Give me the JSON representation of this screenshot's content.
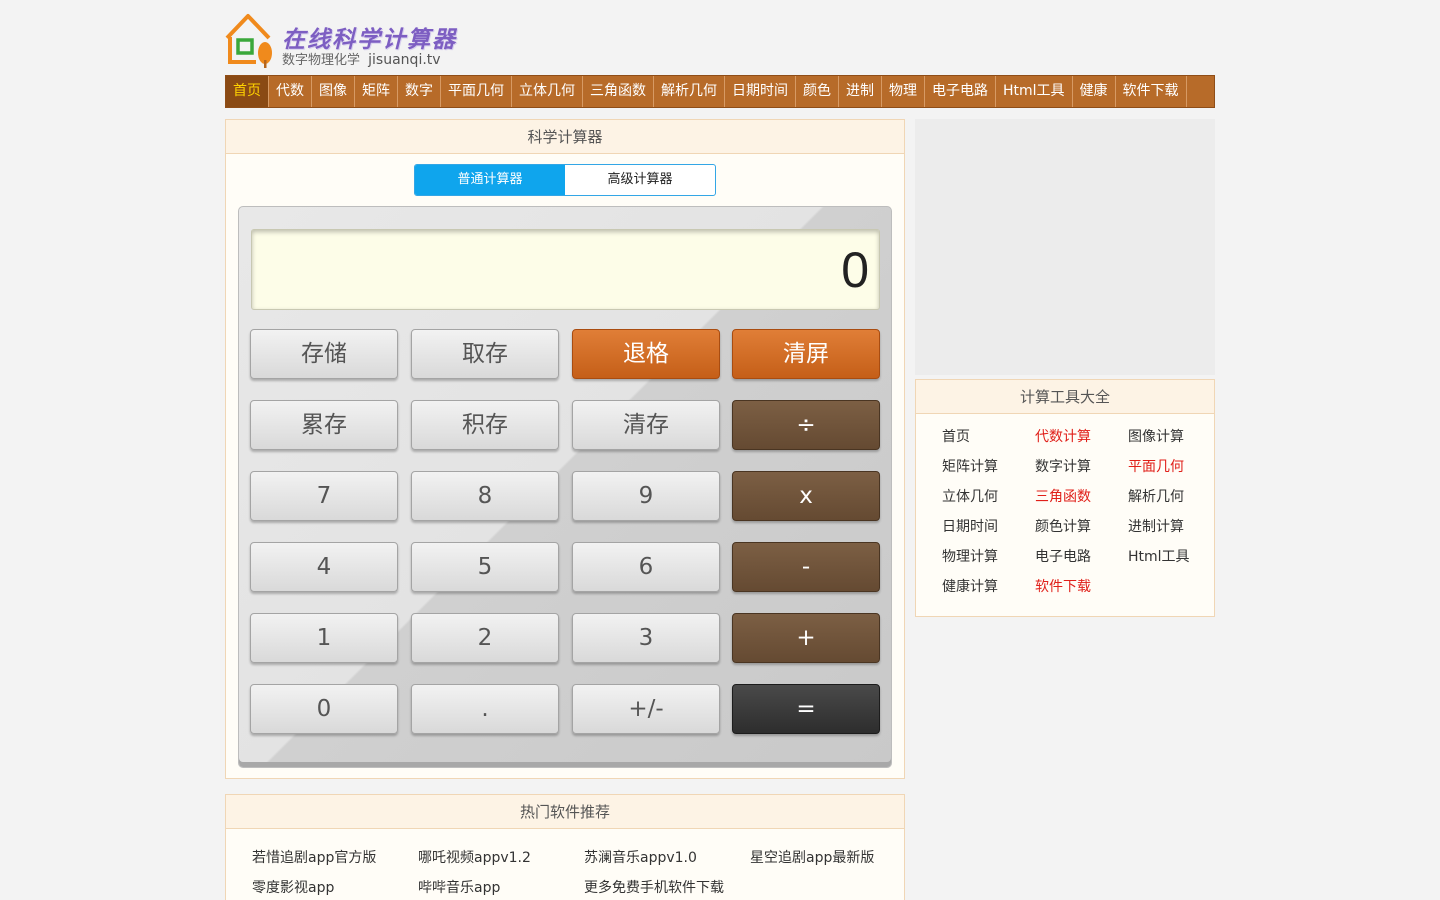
{
  "logo": {
    "title": "在线科学计算器",
    "subtitle": "数字物理化学",
    "domain": "jisuanqi.tv"
  },
  "nav": [
    "首页",
    "代数",
    "图像",
    "矩阵",
    "数字",
    "平面几何",
    "立体几何",
    "三角函数",
    "解析几何",
    "日期时间",
    "颜色",
    "进制",
    "物理",
    "电子电路",
    "Html工具",
    "健康",
    "软件下载"
  ],
  "calculator": {
    "title": "科学计算器",
    "tabs": [
      "普通计算器",
      "高级计算器"
    ],
    "display": "0",
    "keys": [
      [
        "存储",
        "取存",
        "退格",
        "清屏"
      ],
      [
        "累存",
        "积存",
        "清存",
        "÷"
      ],
      [
        "7",
        "8",
        "9",
        "x"
      ],
      [
        "4",
        "5",
        "6",
        "-"
      ],
      [
        "1",
        "2",
        "3",
        "+"
      ],
      [
        "0",
        ".",
        "+/-",
        "="
      ]
    ]
  },
  "tools": {
    "title": "计算工具大全",
    "links": [
      "首页",
      "代数计算",
      "图像计算",
      "矩阵计算",
      "数字计算",
      "平面几何",
      "立体几何",
      "三角函数",
      "解析几何",
      "日期时间",
      "颜色计算",
      "进制计算",
      "物理计算",
      "电子电路",
      "Html工具",
      "健康计算",
      "软件下载"
    ]
  },
  "software": {
    "title": "热门软件推荐",
    "links": [
      "若惜追剧app官方版",
      "哪吒视频appv1.2",
      "苏澜音乐appv1.0",
      "星空追剧app最新版",
      "零度影视app",
      "哔哔音乐app",
      "更多免费手机软件下载"
    ]
  },
  "colors": {
    "nav_bg": "#b76b29",
    "nav_active_text": "#ffd200",
    "tab_active": "#0fa5ed",
    "key_orange": "#d06a24",
    "key_brown": "#735840",
    "key_dark": "#3a3a3a",
    "link_red": "#e0201a"
  }
}
